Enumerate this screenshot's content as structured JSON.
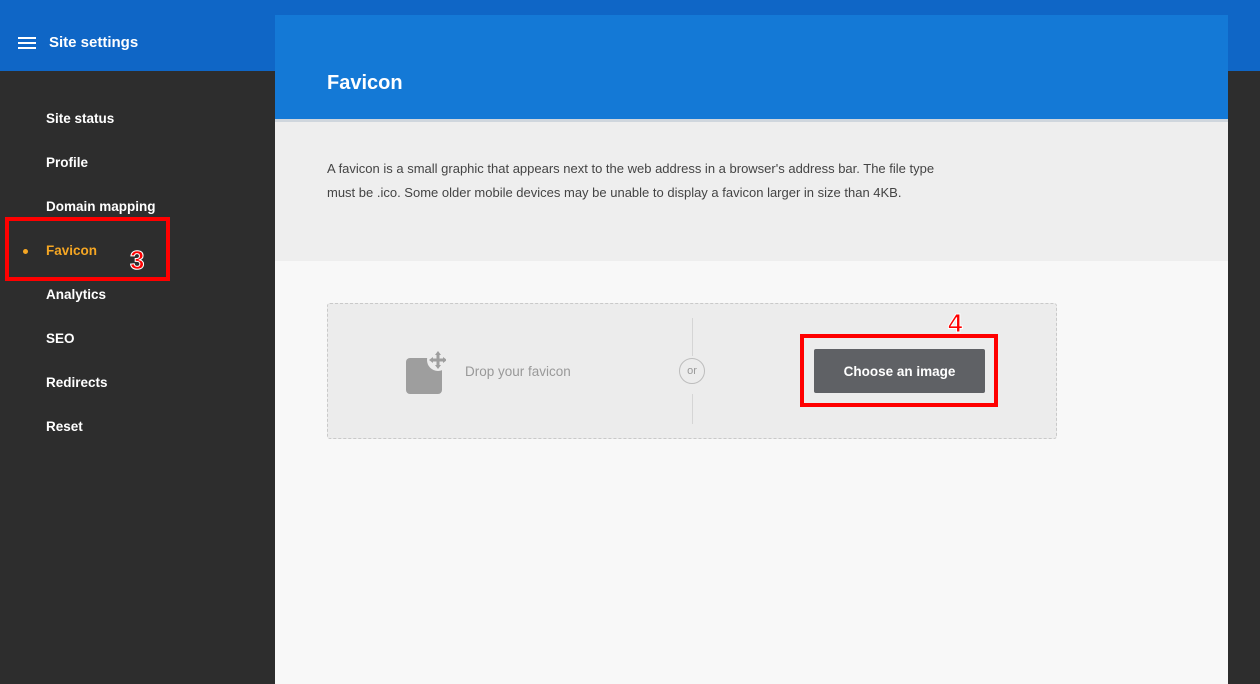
{
  "header": {
    "menu_icon": "hamburger-icon",
    "site_title": "Site settings"
  },
  "sidebar": {
    "items": [
      {
        "label": "Site status",
        "active": false
      },
      {
        "label": "Profile",
        "active": false
      },
      {
        "label": "Domain mapping",
        "active": false
      },
      {
        "label": "Favicon",
        "active": true
      },
      {
        "label": "Analytics",
        "active": false
      },
      {
        "label": "SEO",
        "active": false
      },
      {
        "label": "Redirects",
        "active": false
      },
      {
        "label": "Reset",
        "active": false
      }
    ]
  },
  "main": {
    "title": "Favicon",
    "description": "A favicon is a small graphic that appears next to the web address in a browser's address bar. The file type must be .ico. Some older mobile devices may be unable to display a favicon larger in size than 4KB.",
    "dropzone": {
      "icon": "image-upload-icon",
      "label": "Drop your favicon",
      "or_label": "or",
      "button_label": "Choose an image"
    }
  },
  "annotations": {
    "step_3": "3",
    "step_4": "4"
  },
  "colors": {
    "header_blue": "#0f66c6",
    "title_blue": "#1479d6",
    "sidebar_bg": "#2d2d2d",
    "active_orange": "#f5a623",
    "annotation_red": "#ff0000",
    "button_gray": "#5f6165"
  }
}
